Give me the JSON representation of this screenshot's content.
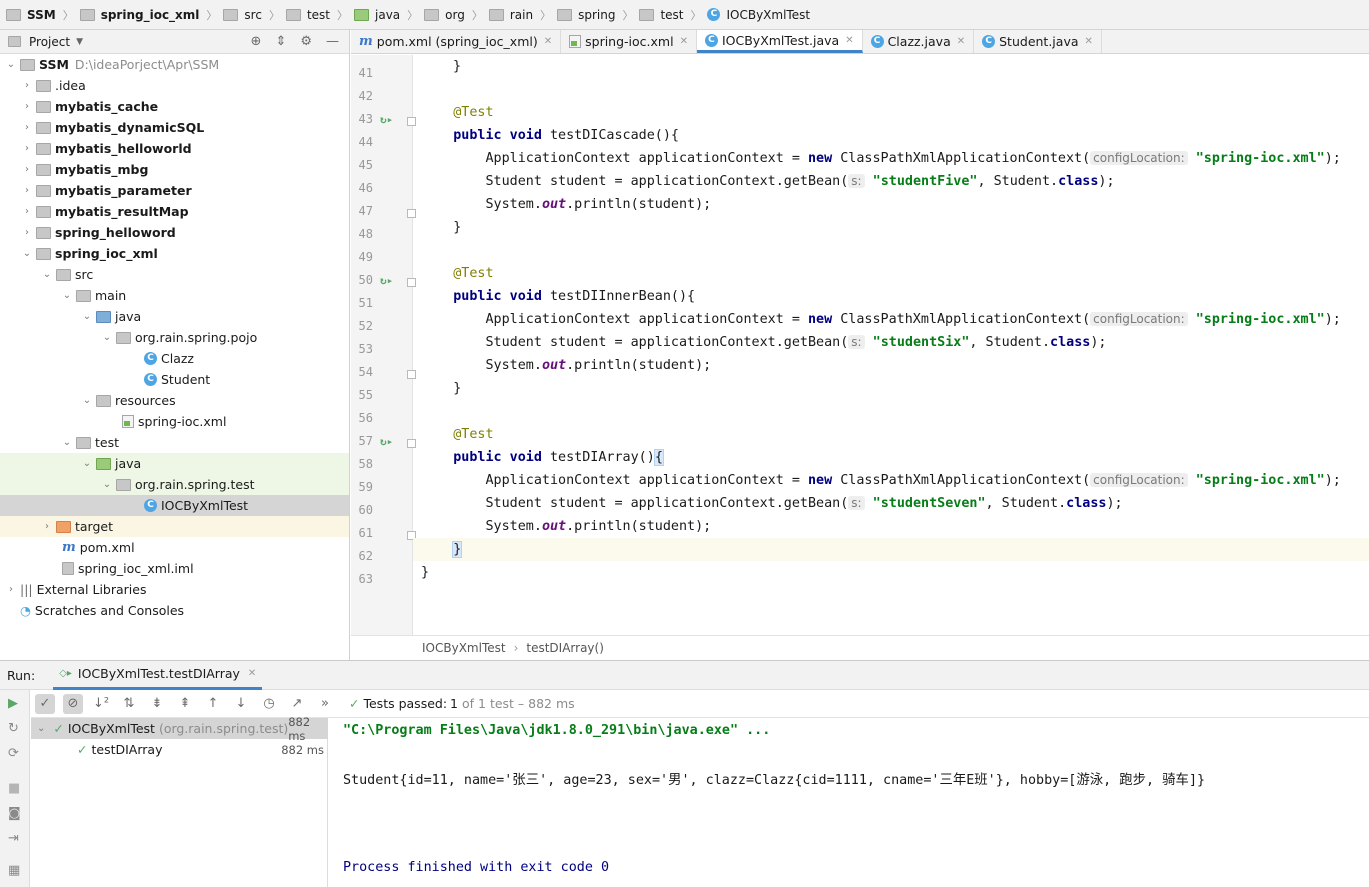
{
  "navbar": {
    "crumbs": [
      "SSM",
      "spring_ioc_xml",
      "src",
      "test",
      "java",
      "org",
      "rain",
      "spring",
      "test",
      "IOCByXmlTest"
    ]
  },
  "project": {
    "title": "Project",
    "tree": [
      {
        "label": "SSM",
        "path": "D:\\ideaPorject\\Apr\\SSM"
      },
      {
        "label": ".idea"
      },
      {
        "label": "mybatis_cache"
      },
      {
        "label": "mybatis_dynamicSQL"
      },
      {
        "label": "mybatis_helloworld"
      },
      {
        "label": "mybatis_mbg"
      },
      {
        "label": "mybatis_parameter"
      },
      {
        "label": "mybatis_resultMap"
      },
      {
        "label": "spring_helloword"
      },
      {
        "label": "spring_ioc_xml"
      },
      {
        "label": "src"
      },
      {
        "label": "main"
      },
      {
        "label": "java"
      },
      {
        "label": "org.rain.spring.pojo"
      },
      {
        "label": "Clazz"
      },
      {
        "label": "Student"
      },
      {
        "label": "resources"
      },
      {
        "label": "spring-ioc.xml"
      },
      {
        "label": "test"
      },
      {
        "label": "java"
      },
      {
        "label": "org.rain.spring.test"
      },
      {
        "label": "IOCByXmlTest"
      },
      {
        "label": "target"
      },
      {
        "label": "pom.xml"
      },
      {
        "label": "spring_ioc_xml.iml"
      },
      {
        "label": "External Libraries"
      },
      {
        "label": "Scratches and Consoles"
      }
    ]
  },
  "tabs": [
    {
      "label": "pom.xml (spring_ioc_xml)"
    },
    {
      "label": "spring-ioc.xml"
    },
    {
      "label": "IOCByXmlTest.java"
    },
    {
      "label": "Clazz.java"
    },
    {
      "label": "Student.java"
    }
  ],
  "editor": {
    "lines": [
      "41",
      "42",
      "43",
      "44",
      "45",
      "46",
      "47",
      "48",
      "49",
      "50",
      "51",
      "52",
      "53",
      "54",
      "55",
      "56",
      "57",
      "58",
      "59",
      "60",
      "61",
      "62",
      "63"
    ],
    "code": {
      "l41": "}",
      "ann": "@Test",
      "public_void": "public void ",
      "m1": "testDICascade(){",
      "m2": "testDIInnerBean(){",
      "m3": "testDIArray()",
      "brace_open": "{",
      "ctx_start": "ApplicationContext applicationContext = ",
      "new_kw": "new ",
      "ctx_class": "ClassPathXmlApplicationContext(",
      "hint_config": "configLocation:",
      "xml_str": "\"spring-ioc.xml\"",
      "ctx_end": ");",
      "student_start": "Student student = applicationContext.getBean(",
      "hint_s": "s:",
      "bean5": "\"studentFive\"",
      "bean6": "\"studentSix\"",
      "bean7": "\"studentSeven\"",
      "class_mid": ", Student.",
      "class_kw": "class",
      "print_start": "System.",
      "print_out": "out",
      "print_end": ".println(student);",
      "close_brace": "}"
    },
    "breadcrumbs": [
      "IOCByXmlTest",
      "testDIArray()"
    ]
  },
  "run": {
    "label": "Run:",
    "tab": "IOCByXmlTest.testDIArray",
    "status_prefix": "Tests passed: ",
    "status_count": "1",
    "status_rest": "of 1 test – 882 ms",
    "tree": [
      {
        "name": "IOCByXmlTest",
        "pkg": "(org.rain.spring.test)",
        "dur": "882 ms"
      },
      {
        "name": "testDIArray",
        "dur": "882 ms"
      }
    ],
    "console": [
      "\"C:\\Program Files\\Java\\jdk1.8.0_291\\bin\\java.exe\" ...",
      "Student{id=11, name='张三', age=23, sex='男', clazz=Clazz{cid=1111, cname='三年E班'}, hobby=[游泳, 跑步, 骑车]}",
      "Process finished with exit code 0"
    ]
  }
}
